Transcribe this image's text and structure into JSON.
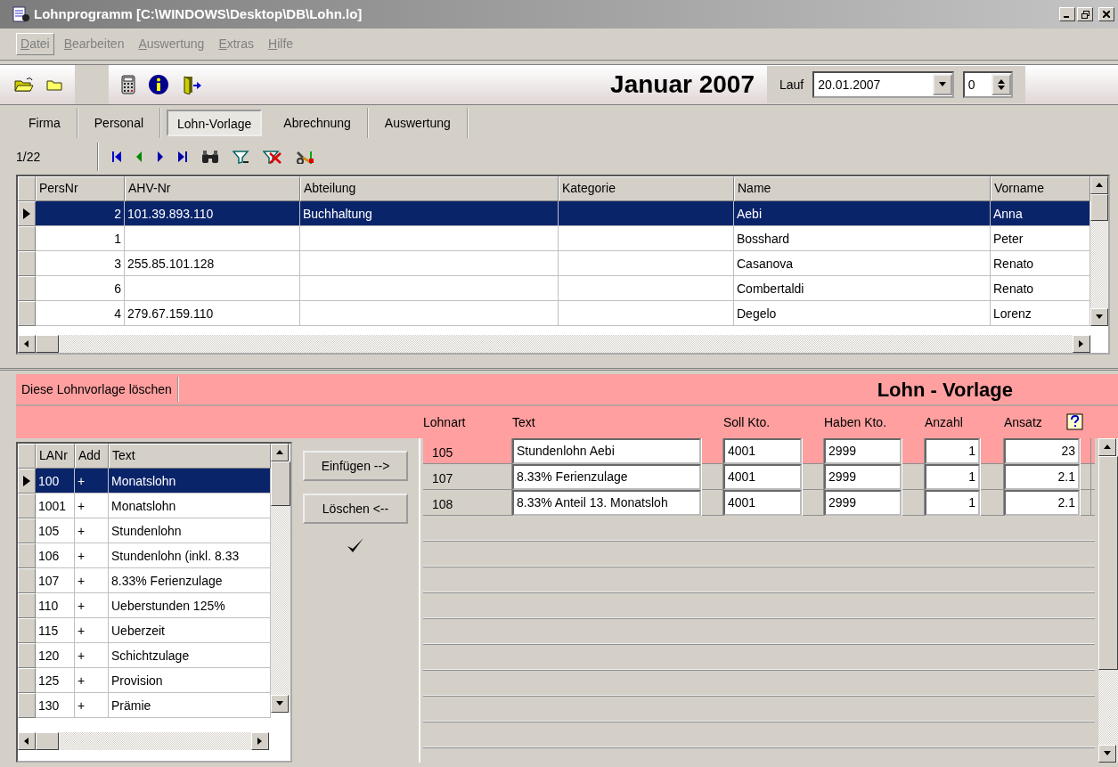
{
  "window": {
    "title": "Lohnprogramm [C:\\WINDOWS\\Desktop\\DB\\Lohn.lo]"
  },
  "menu": [
    {
      "label": "Datei",
      "selected": true
    },
    {
      "label": "Bearbeiten",
      "selected": false
    },
    {
      "label": "Auswertung",
      "selected": false
    },
    {
      "label": "Extras",
      "selected": false
    },
    {
      "label": "Hilfe",
      "selected": false
    }
  ],
  "toolbar": {
    "period": "Januar 2007",
    "run_label": "Lauf",
    "run_date": "20.01.2007",
    "run_number": "0"
  },
  "tabs": [
    {
      "label": "Firma",
      "selected": false
    },
    {
      "label": "Personal",
      "selected": false
    },
    {
      "label": "Lohn-Vorlage",
      "selected": true
    },
    {
      "label": "Abrechnung",
      "selected": false
    },
    {
      "label": "Auswertung",
      "selected": false
    }
  ],
  "navigator": {
    "position": "1/22"
  },
  "persons": {
    "columns": [
      "PersNr",
      "AHV-Nr",
      "Abteilung",
      "Kategorie",
      "Name",
      "Vorname"
    ],
    "rows": [
      {
        "pers_nr": "2",
        "ahv_nr": "101.39.893.110",
        "department": "Buchhaltung",
        "name": "Aebi",
        "first_name": "Anna",
        "selected": true
      },
      {
        "pers_nr": "1",
        "name": "Bosshard",
        "first_name": "Peter",
        "selected": false
      },
      {
        "pers_nr": "3",
        "ahv_nr": "255.85.101.128",
        "name": "Casanova",
        "first_name": "Renato",
        "selected": false
      },
      {
        "pers_nr": "6",
        "name": "Combertaldi",
        "first_name": "Renato",
        "selected": false
      },
      {
        "pers_nr": "4",
        "ahv_nr": "279.67.159.110",
        "name": "Degelo",
        "first_name": "Lorenz",
        "selected": false
      }
    ]
  },
  "template": {
    "delete_button": "Diese Lohnvorlage löschen",
    "title": "Lohn - Vorlage"
  },
  "wage_types": {
    "columns": [
      "LANr",
      "Add",
      "Text"
    ],
    "rows": [
      {
        "number": "100",
        "add": "+",
        "text": "Monatslohn",
        "selected": true
      },
      {
        "number": "1001",
        "add": "+",
        "text": "Monatslohn",
        "selected": false
      },
      {
        "number": "105",
        "add": "+",
        "text": "Stundenlohn",
        "selected": false
      },
      {
        "number": "106",
        "add": "+",
        "text": "Stundenlohn (inkl. 8.33",
        "selected": false
      },
      {
        "number": "107",
        "add": "+",
        "text": "8.33% Ferienzulage",
        "selected": false
      },
      {
        "number": "110",
        "add": "+",
        "text": "Ueberstunden 125%",
        "selected": false
      },
      {
        "number": "115",
        "add": "+",
        "text": "Ueberzeit",
        "selected": false
      },
      {
        "number": "120",
        "add": "+",
        "text": "Schichtzulage",
        "selected": false
      },
      {
        "number": "125",
        "add": "+",
        "text": "Provision",
        "selected": false
      },
      {
        "number": "130",
        "add": "+",
        "text": "Prämie",
        "selected": false
      }
    ]
  },
  "actions": {
    "insert": "Einfügen -->",
    "remove": "Löschen <--"
  },
  "template_lines": {
    "columns": [
      "Lohnart",
      "Text",
      "Soll Kto.",
      "Haben Kto.",
      "Anzahl",
      "Ansatz"
    ],
    "rows": [
      {
        "wage_type": "105",
        "text": "Stundenlohn Aebi",
        "debit": "4001",
        "credit": "2999",
        "count": "1",
        "rate": "23",
        "selected": true
      },
      {
        "wage_type": "107",
        "text": "8.33% Ferienzulage",
        "debit": "4001",
        "credit": "2999",
        "count": "1",
        "rate": "2.1",
        "selected": false
      },
      {
        "wage_type": "108",
        "text": "8.33% Anteil 13. Monatsloh",
        "debit": "4001",
        "credit": "2999",
        "count": "1",
        "rate": "2.1",
        "selected": false
      }
    ]
  }
}
